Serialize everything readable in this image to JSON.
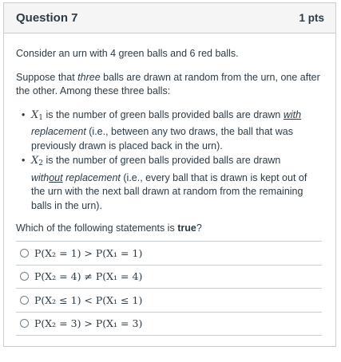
{
  "question": {
    "title": "Question 7",
    "points": "1 pts"
  },
  "body": {
    "intro": "Consider an urn with 4 green balls and 6 red balls.",
    "setup_pre": "Suppose that ",
    "setup_em": "three",
    "setup_post": " balls are drawn at random from the urn, one after the other. Among these three balls:",
    "bullets": [
      {
        "var": "X",
        "sub": "1",
        "text_a": " is the number of green balls provided balls are drawn ",
        "u_text": "with",
        "em_text": " replacement",
        "text_b": " (i.e., between any two draws, the ball that was previously drawn is placed back in the urn)."
      },
      {
        "var": "X",
        "sub": "2",
        "text_a": " is the number of green balls provided balls are drawn ",
        "em_text2": "with",
        "u_text": "out",
        "em_text": " replacement",
        "text_b": " (i.e., every ball that is drawn is kept out of the urn with the next ball drawn at random from the remaining balls in the urn)."
      }
    ],
    "prompt_pre": "Which of the following statements is ",
    "prompt_bold": "true",
    "prompt_post": "?"
  },
  "answers": [
    "P(X₂ = 1) > P(X₁ = 1)",
    "P(X₂ = 4) ≠ P(X₁ = 4)",
    "P(X₂ ≤ 1) < P(X₁ ≤ 1)",
    "P(X₂ = 3) > P(X₁ = 3)"
  ]
}
